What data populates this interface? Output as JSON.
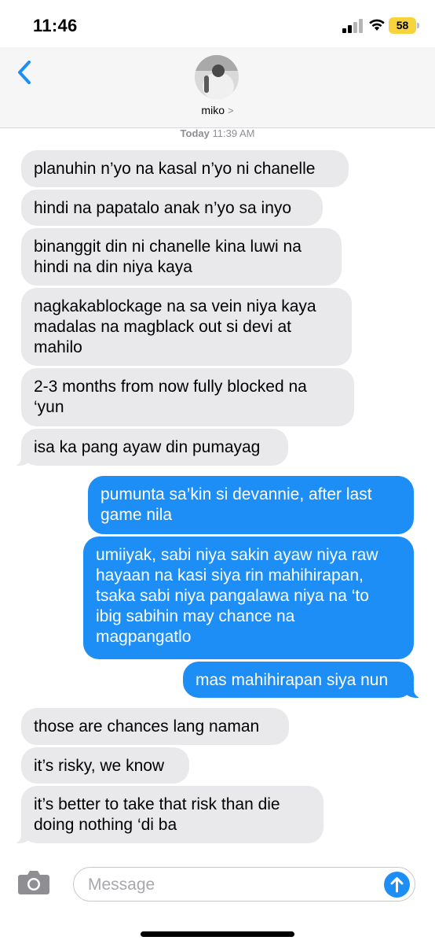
{
  "status_bar": {
    "time": "11:46",
    "battery": "58",
    "icons": [
      "cellular-signal-icon",
      "wifi-icon",
      "battery-icon"
    ]
  },
  "header": {
    "contact_name": "miko",
    "chevron": ">",
    "back_icon": "chevron-left-icon"
  },
  "timestamp": {
    "day": "Today",
    "time": "11:39 AM"
  },
  "messages": [
    {
      "from": "other",
      "lines": [
        "planuhin n’yo na kasal n’yo ni chanelle"
      ]
    },
    {
      "from": "other",
      "lines": [
        "hindi na papatalo anak n’yo sa inyo"
      ]
    },
    {
      "from": "other",
      "lines": [
        "binanggit din ni chanelle kina luwi na",
        "hindi na din niya kaya"
      ]
    },
    {
      "from": "other",
      "lines": [
        "nagkakablockage na sa vein niya kaya",
        "madalas na magblack out si devi at",
        "mahilo"
      ]
    },
    {
      "from": "other",
      "lines": [
        "2-3 months from now fully blocked na",
        "‘yun"
      ]
    },
    {
      "from": "other",
      "lines": [
        "isa ka pang ayaw din pumayag"
      ]
    },
    {
      "from": "me",
      "lines": [
        "pumunta sa’kin si devannie, after last",
        "game nila"
      ]
    },
    {
      "from": "me",
      "lines": [
        "umiiyak, sabi niya sakin ayaw niya raw",
        "hayaan na kasi siya rin mahihirapan,",
        "tsaka sabi niya pangalawa niya na ‘to",
        "ibig sabihin may chance na",
        "magpangatlo"
      ]
    },
    {
      "from": "me",
      "lines": [
        "mas mahihirapan siya nun"
      ]
    },
    {
      "from": "other",
      "lines": [
        "those are chances lang naman"
      ]
    },
    {
      "from": "other",
      "lines": [
        "it’s risky, we know"
      ]
    },
    {
      "from": "other",
      "lines": [
        "it’s better to take that risk than die",
        "doing nothing ‘di ba"
      ]
    }
  ],
  "composer": {
    "placeholder": "Message",
    "value": "",
    "camera_icon": "camera-icon",
    "send_icon": "send-arrow-icon"
  },
  "colors": {
    "sent_bubble": "#1e8ef7",
    "received_bubble": "#e9e9eb",
    "accent": "#1e8ef7",
    "battery": "#f7d33e"
  }
}
